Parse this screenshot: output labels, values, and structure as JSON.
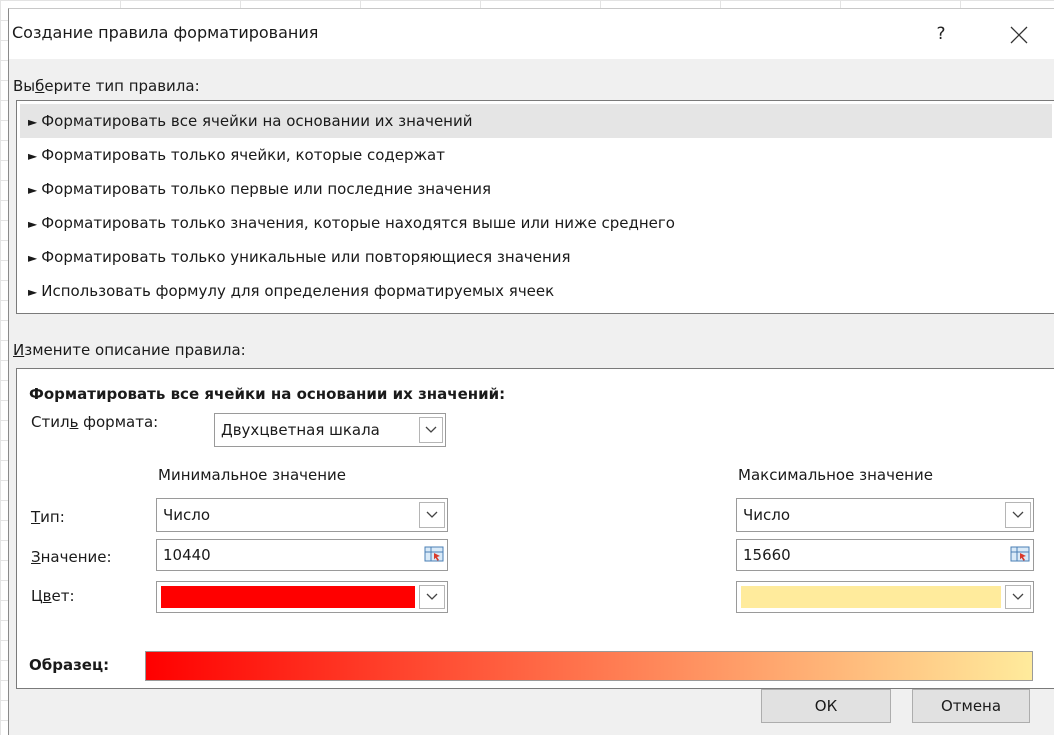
{
  "window": {
    "title": "Создание правила форматирования",
    "help_label": "?"
  },
  "rule_type": {
    "label_pre": "Вы",
    "label_accel": "б",
    "label_post": "ерите тип правила:",
    "items": [
      {
        "label": "Форматировать все ячейки на основании их значений",
        "selected": true
      },
      {
        "label": "Форматировать только ячейки, которые содержат",
        "selected": false
      },
      {
        "label": "Форматировать только первые или последние значения",
        "selected": false
      },
      {
        "label": "Форматировать только значения, которые находятся выше или ниже среднего",
        "selected": false
      },
      {
        "label": "Форматировать только уникальные или повторяющиеся значения",
        "selected": false
      },
      {
        "label": "Использовать формулу для определения форматируемых ячеек",
        "selected": false
      }
    ]
  },
  "description": {
    "label_accel": "И",
    "label_post": "змените описание правила:",
    "heading": "Форматировать все ячейки на основании их значений:",
    "style_label_pre": "Стил",
    "style_label_accel": "ь",
    "style_label_post": " формата:",
    "style_value": "Двухцветная шкала",
    "min_header": "Минимальное значение",
    "max_header": "Максимальное значение",
    "type_label_accel": "Т",
    "type_label_post": "ип:",
    "value_label_accel": "З",
    "value_label_post": "начение:",
    "color_label_pre": "Ц",
    "color_label_accel": "в",
    "color_label_post": "ет:",
    "min_type": "Число",
    "max_type": "Число",
    "min_value": "10440",
    "max_value": "15660",
    "sample_label": "Образец:"
  },
  "colors": {
    "min_color": "#ff0000",
    "max_color": "#ffeb9c"
  },
  "buttons": {
    "ok": "ОК",
    "cancel": "Отмена"
  }
}
